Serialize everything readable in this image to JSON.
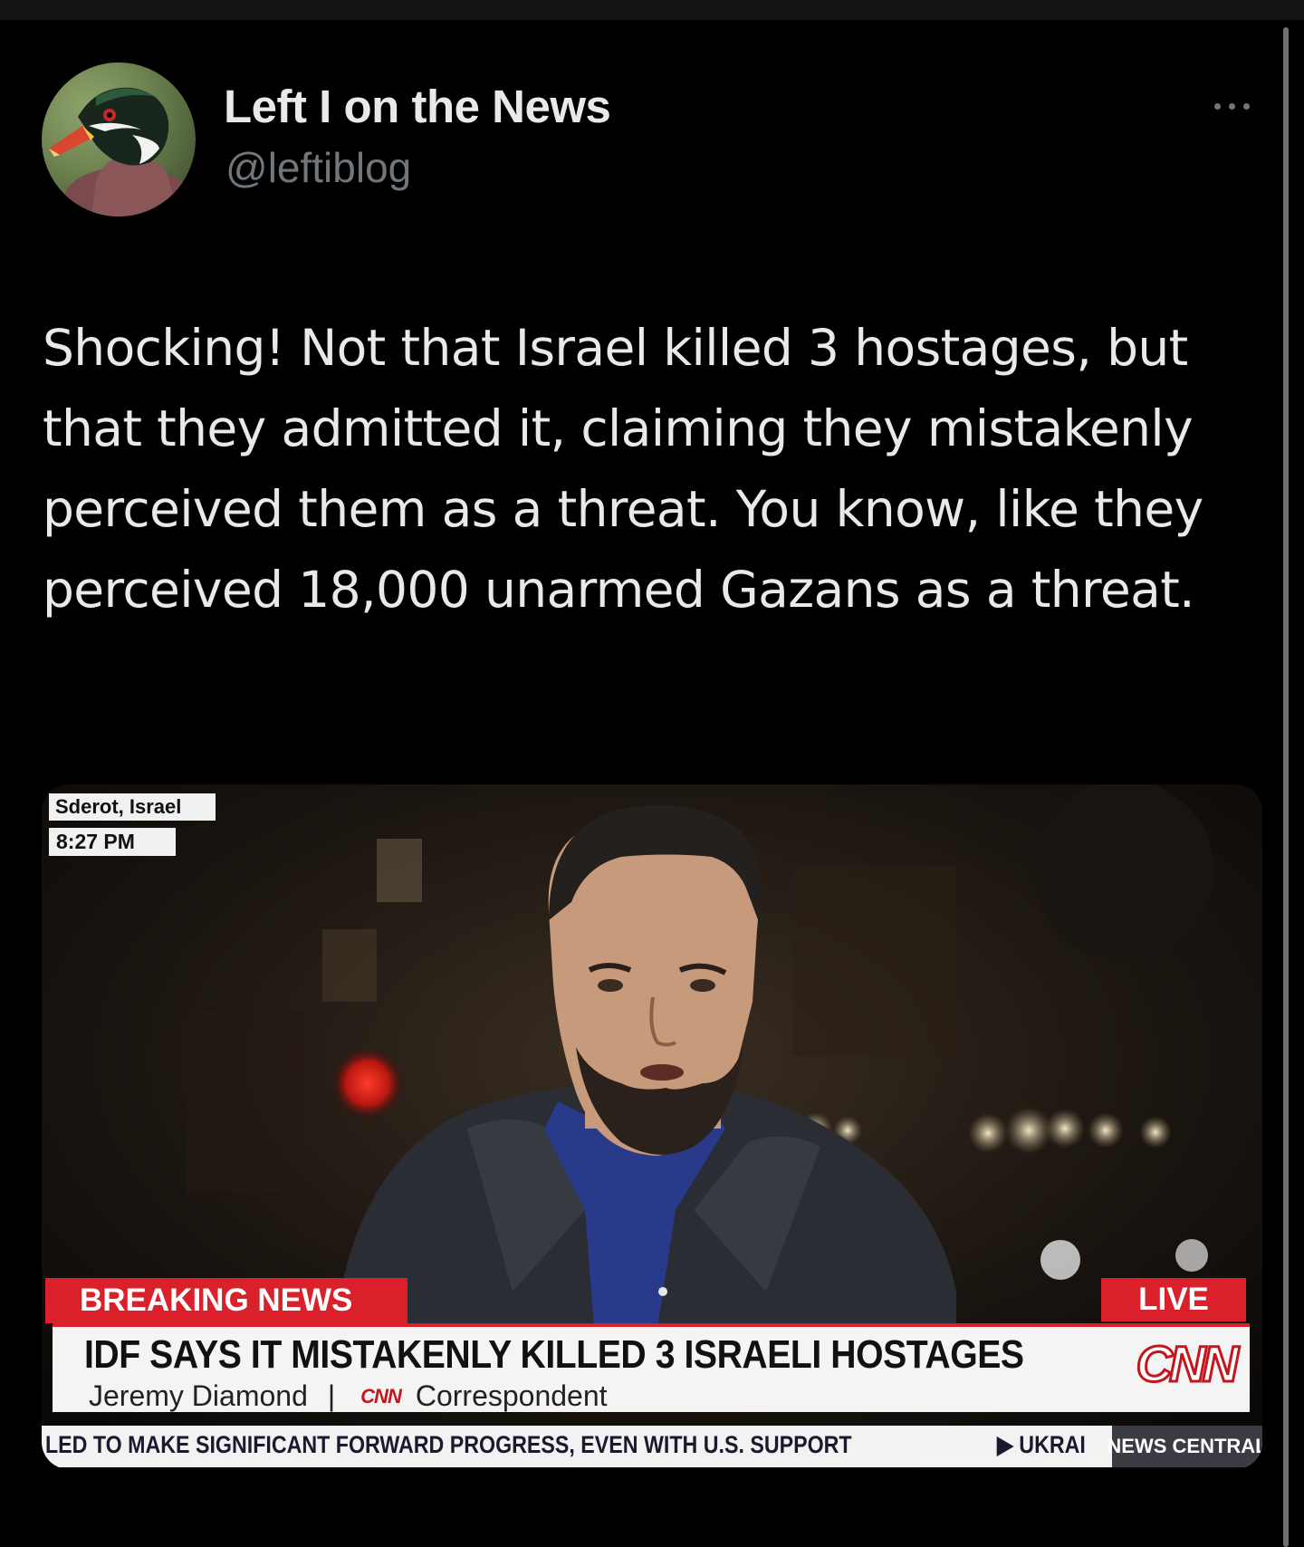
{
  "tweet": {
    "author": {
      "display_name": "Left I on the News",
      "handle": "@leftiblog",
      "avatar_icon": "wood-duck-avatar"
    },
    "text": "Shocking! Not that Israel killed 3 hostages, but that they admitted it, claiming they mistakenly perceived them as a threat. You know, like they perceived 18,000 unarmed Gazans as a threat.",
    "more_icon": "more-options-icon"
  },
  "media": {
    "location": "Sderot, Israel",
    "time": "8:27 PM",
    "breaking_label": "BREAKING NEWS",
    "live_label": "LIVE",
    "headline": "IDF SAYS IT MISTAKENLY KILLED 3 ISRAELI HOSTAGES",
    "reporter_name": "Jeremy Diamond",
    "separator": "|",
    "network_mini": "CNN",
    "reporter_title": "Correspondent",
    "network_logo": "CNN",
    "ticker_text": "LED TO MAKE SIGNIFICANT FORWARD PROGRESS, EVEN WITH U.S. SUPPORT",
    "ticker_next": "▶ UKRAI",
    "ticker_brand": "NEWS CENTRAL"
  },
  "colors": {
    "background": "#000000",
    "text": "#e7e9ea",
    "secondary_text": "#71767b",
    "cnn_red": "#d9202b"
  }
}
